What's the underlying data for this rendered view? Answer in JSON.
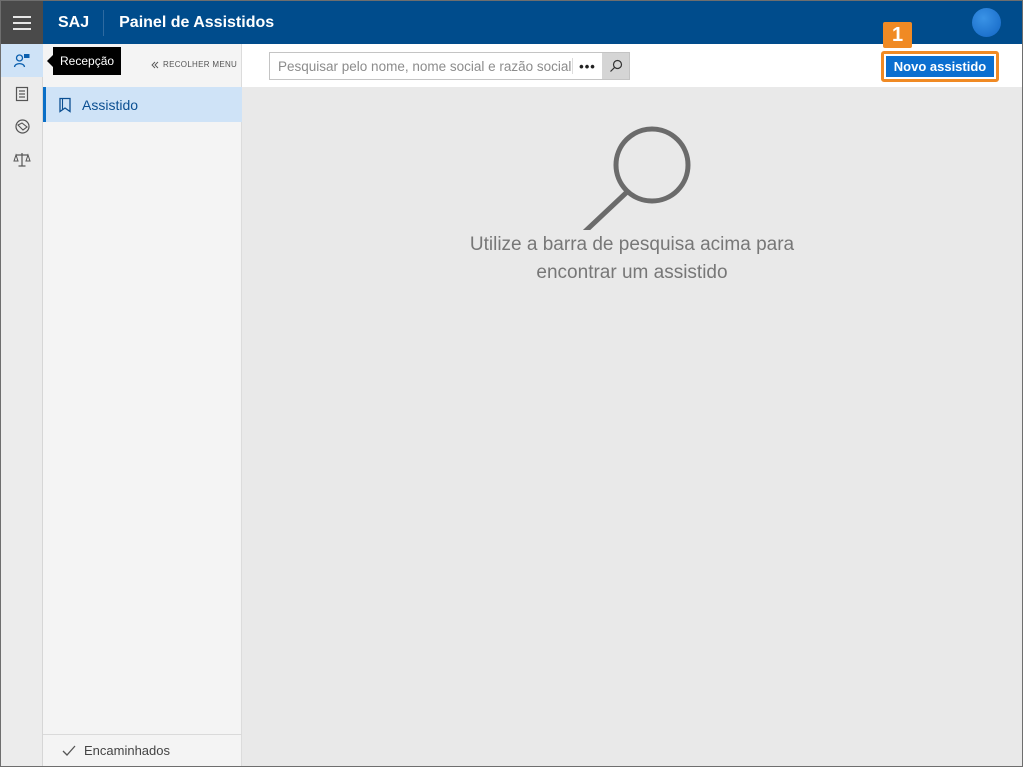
{
  "header": {
    "app_name": "SAJ",
    "title": "Painel de Assistidos"
  },
  "rail": {
    "items": [
      "person-desk-icon",
      "clipboard-list-icon",
      "handshake-icon",
      "scales-icon"
    ],
    "tooltip": "Recepção"
  },
  "nav": {
    "collapse_label": "RECOLHER MENU",
    "items": [
      {
        "label": "Assistido",
        "icon": "bookmark-icon",
        "active": true
      }
    ],
    "footer_label": "Encaminhados"
  },
  "search": {
    "placeholder": "Pesquisar pelo nome, nome social e razão social",
    "more_label": "•••"
  },
  "toolbar": {
    "new_button_label": "Novo assistido",
    "callout_number": "1"
  },
  "empty_state": {
    "line1": "Utilize a barra de pesquisa acima para",
    "line2": "encontrar um assistido"
  },
  "colors": {
    "header_bg": "#004c8c",
    "accent": "#0b6fd0",
    "callout": "#f08a24"
  }
}
